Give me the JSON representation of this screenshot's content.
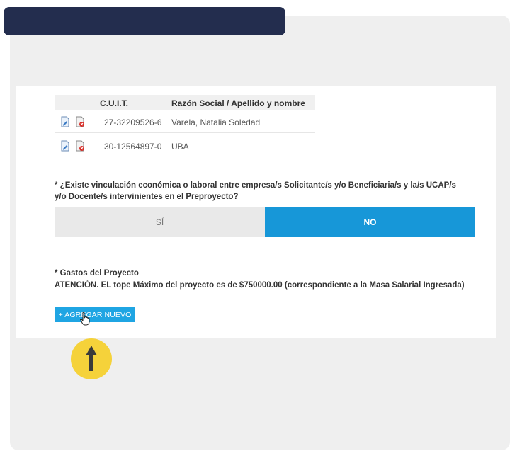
{
  "table": {
    "headers": {
      "cuit": "C.U.I.T.",
      "razon": "Razón Social / Apellido y nombre"
    },
    "rows": [
      {
        "cuit": "27-32209526-6",
        "razon": "Varela, Natalia Soledad"
      },
      {
        "cuit": "30-12564897-0",
        "razon": "UBA"
      }
    ]
  },
  "question": {
    "text": "* ¿Existe vinculación económica o laboral entre empresa/s Solicitante/s y/o Beneficiaria/s y la/s UCAP/s y/o Docente/s intervinientes en el Preproyecto?"
  },
  "toggle": {
    "si_label": "SÍ",
    "no_label": "NO",
    "selected": "NO"
  },
  "gastos": {
    "title": "* Gastos del Proyecto",
    "notice": "ATENCIÓN. EL tope Máximo del proyecto es de $750000.00 (correspondiente a la Masa Salarial Ingresada)",
    "add_label": "+ AGREGAR NUEVO"
  },
  "colors": {
    "header_bar": "#232d4e",
    "accent": "#1797d8",
    "highlight": "#f5d23a"
  },
  "icons": [
    "edit-document-icon",
    "delete-document-icon",
    "hand-cursor-icon",
    "up-arrow-icon"
  ]
}
